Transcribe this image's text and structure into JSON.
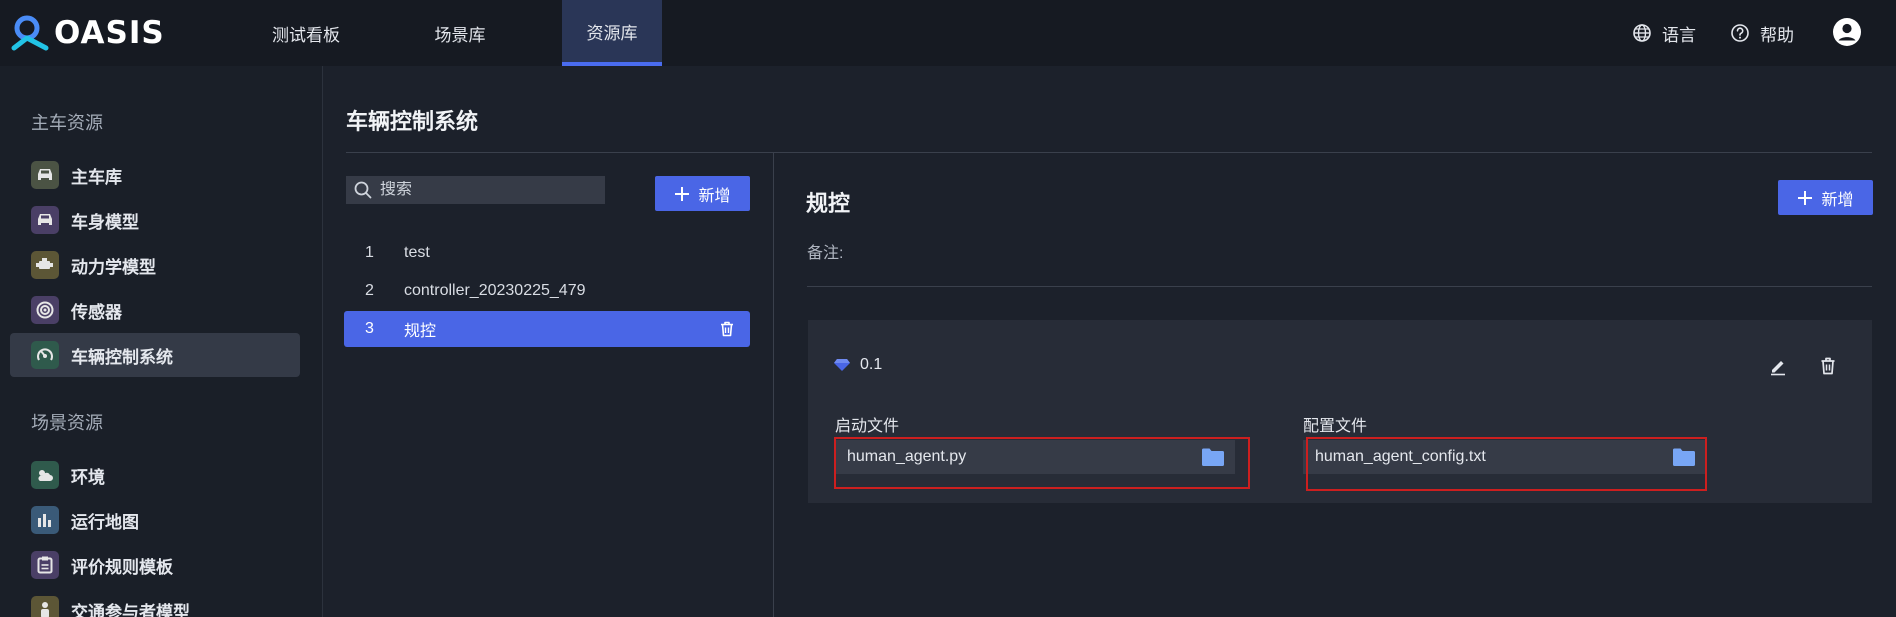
{
  "brand": {
    "logo_text": "OASIS"
  },
  "nav": {
    "tabs": [
      {
        "label": "测试看板",
        "active": false
      },
      {
        "label": "场景库",
        "active": false
      },
      {
        "label": "资源库",
        "active": true
      }
    ],
    "language_label": "语言",
    "help_label": "帮助"
  },
  "sidebar": {
    "sections": [
      {
        "title": "主车资源",
        "items": [
          {
            "label": "主车库",
            "icon": "car-front-icon",
            "active": false
          },
          {
            "label": "车身模型",
            "icon": "car-body-icon",
            "active": false
          },
          {
            "label": "动力学模型",
            "icon": "engine-icon",
            "active": false
          },
          {
            "label": "传感器",
            "icon": "radar-icon",
            "active": false
          },
          {
            "label": "车辆控制系统",
            "icon": "steering-icon",
            "active": true
          }
        ]
      },
      {
        "title": "场景资源",
        "items": [
          {
            "label": "环境",
            "icon": "weather-icon",
            "active": false
          },
          {
            "label": "运行地图",
            "icon": "map-icon",
            "active": false
          },
          {
            "label": "评价规则模板",
            "icon": "clipboard-icon",
            "active": false
          },
          {
            "label": "交通参与者模型",
            "icon": "traffic-participant-icon",
            "active": false
          }
        ]
      }
    ]
  },
  "main": {
    "page_title": "车辆控制系统",
    "search": {
      "placeholder": "搜索",
      "value": ""
    },
    "add_label": "新增",
    "list": [
      {
        "index": "1",
        "name": "test",
        "active": false
      },
      {
        "index": "2",
        "name": "controller_20230225_479",
        "active": false
      },
      {
        "index": "3",
        "name": "规控",
        "active": true
      }
    ]
  },
  "detail": {
    "title": "规控",
    "add_label": "新增",
    "remark_label": "备注:",
    "version": {
      "name": "0.1",
      "startup_label": "启动文件",
      "startup_file": "human_agent.py",
      "config_label": "配置文件",
      "config_file": "human_agent_config.txt"
    }
  },
  "colors": {
    "accent": "#4a66e6",
    "topbar_bg": "#161a22",
    "page_bg": "#1c212b",
    "highlight_box": "#cc1f1f",
    "folder": "#78a6f5"
  }
}
